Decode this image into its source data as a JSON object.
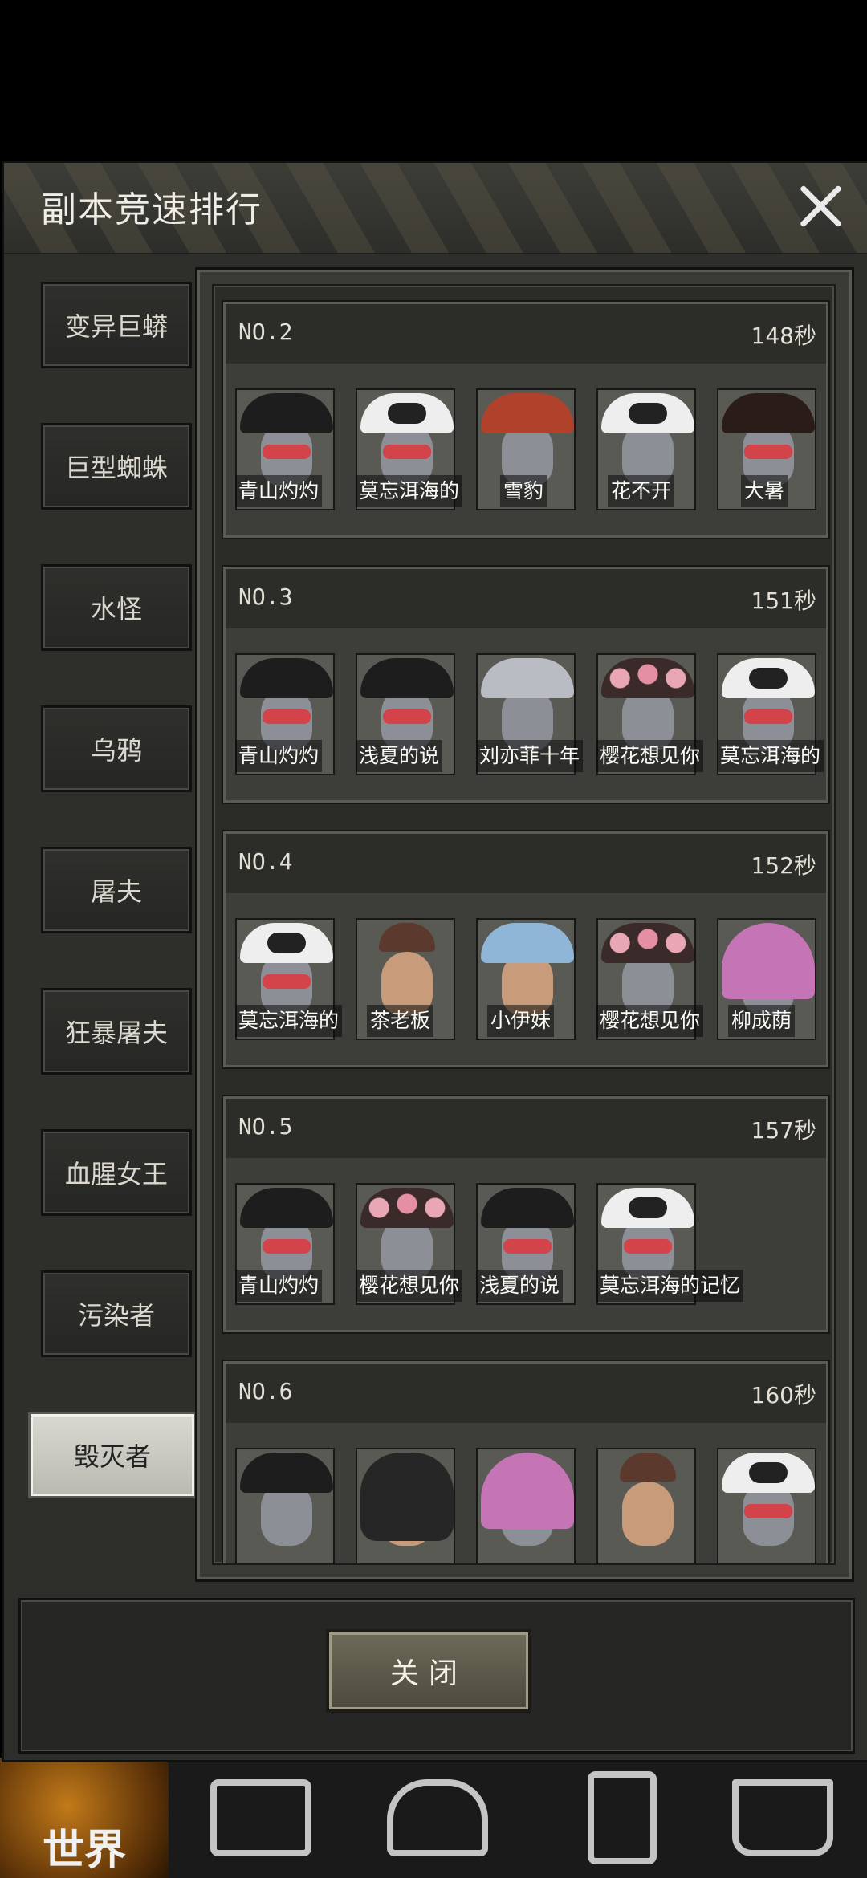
{
  "title": "副本竞速排行",
  "sidebar": {
    "items": [
      {
        "label": "变异巨蟒"
      },
      {
        "label": "巨型蜘蛛"
      },
      {
        "label": "水怪"
      },
      {
        "label": "乌鸦"
      },
      {
        "label": "屠夫"
      },
      {
        "label": "狂暴屠夫"
      },
      {
        "label": "血腥女王"
      },
      {
        "label": "污染者"
      },
      {
        "label": "毁灭者",
        "selected": true
      }
    ]
  },
  "rankings": [
    {
      "rank": "NO.2",
      "time": "148秒",
      "members": [
        "青山灼灼",
        "莫忘洱海的",
        "雪豹",
        "花不开",
        "大暑"
      ]
    },
    {
      "rank": "NO.3",
      "time": "151秒",
      "members": [
        "青山灼灼",
        "浅夏的说",
        "刘亦菲十年",
        "樱花想见你",
        "莫忘洱海的"
      ]
    },
    {
      "rank": "NO.4",
      "time": "152秒",
      "members": [
        "莫忘洱海的",
        "茶老板",
        "小伊妹",
        "樱花想见你",
        "柳成荫"
      ]
    },
    {
      "rank": "NO.5",
      "time": "157秒",
      "members": [
        "青山灼灼",
        "樱花想见你",
        "浅夏的说",
        "莫忘洱海的记忆"
      ]
    },
    {
      "rank": "NO.6",
      "time": "160秒",
      "members": [
        "",
        "",
        "",
        "",
        ""
      ]
    }
  ],
  "footer": {
    "close_label": "关闭"
  },
  "bottom_nav": {
    "world_label": "世界"
  }
}
